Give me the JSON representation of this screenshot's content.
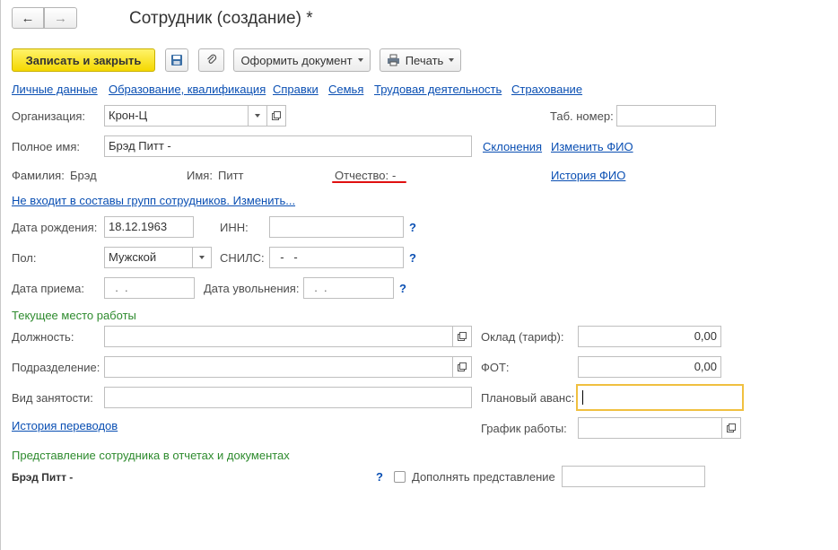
{
  "window": {
    "title": "Сотрудник (создание) *"
  },
  "nav": {
    "back_glyph": "←",
    "forward_glyph": "→"
  },
  "toolbar": {
    "save_close": "Записать и закрыть",
    "form_document": "Оформить документ",
    "print": "Печать"
  },
  "tabs": [
    "Личные данные",
    "Образование, квалификация",
    "Справки",
    "Семья",
    "Трудовая деятельность",
    "Страхование"
  ],
  "org": {
    "label": "Организация:",
    "value": "Крон-Ц",
    "tab_label": "Таб. номер:",
    "tab_value": ""
  },
  "fullname": {
    "label": "Полное имя:",
    "value": "Брэд Питт -",
    "declensions": "Склонения",
    "change_fio": "Изменить ФИО"
  },
  "fio": {
    "surname": "Фамилия:",
    "surname_value": "Брэд",
    "name": "Имя:",
    "name_value": "Питт",
    "patronymic": "Отчество:",
    "patronymic_value": "-",
    "history": "История ФИО"
  },
  "groups_link": "Не входит в составы групп сотрудников. Изменить...",
  "birth": {
    "label": "Дата рождения:",
    "value": "18.12.1963",
    "inn_label": "ИНН:",
    "inn_value": "",
    "help": "?"
  },
  "gender": {
    "label": "Пол:",
    "value": "Мужской",
    "snils_label": "СНИЛС:",
    "snils_value": "  -   -",
    "help": "?"
  },
  "hire": {
    "label": "Дата приема:",
    "value": "  .  .",
    "dismiss_label": "Дата увольнения:",
    "dismiss_value": "  .  .",
    "help": "?"
  },
  "workplace": {
    "section": "Текущее место работы",
    "position": "Должность:",
    "position_value": "",
    "department": "Подразделение:",
    "department_value": "",
    "employment": "Вид занятости:",
    "employment_value": "",
    "salary": "Оклад (тариф):",
    "salary_value": "0,00",
    "fot": "ФОТ:",
    "fot_value": "0,00",
    "advance": "Плановый аванс:",
    "advance_value": "",
    "schedule": "График работы:",
    "schedule_value": "",
    "transfer_history": "История переводов"
  },
  "representation": {
    "section": "Представление сотрудника в отчетах и документах",
    "value": "Брэд Питт -",
    "help": "?",
    "complement": "Дополнять представление",
    "complement_value": ""
  },
  "colors": {
    "accent": "#f5d800",
    "link": "#0a4fb3",
    "section": "#2e8b2e",
    "underline": "#e01010"
  }
}
